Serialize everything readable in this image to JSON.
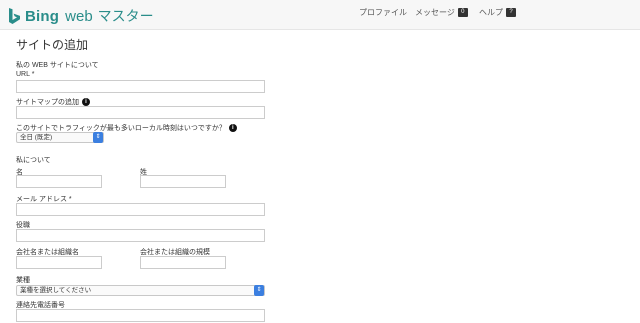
{
  "header": {
    "logo_brand": "Bing",
    "logo_web": "web",
    "logo_master": "マスター",
    "nav": {
      "profile": "プロファイル",
      "messages": "メッセージ",
      "messages_count": "0",
      "help": "ヘルプ",
      "help_count": "?"
    }
  },
  "form": {
    "title": "サイトの追加",
    "my_site_heading": "私の WEB サイトについて",
    "url_label": "URL *",
    "url_value": "",
    "sitemap_label": "サイトマップの追加",
    "sitemap_value": "",
    "traffic_label": "このサイトでトラフィックが最も多いローカル時刻はいつですか？",
    "traffic_select": "全日 (既定)",
    "about_me_heading": "私について",
    "first_name_label": "名",
    "last_name_label": "姓",
    "email_label": "メール アドレス *",
    "job_title_label": "役職",
    "company_label": "会社名または組織名",
    "company_size_label": "会社または組織の規模",
    "industry_label": "業種",
    "industry_select": "業種を選択してください",
    "phone_label": "連絡先電話番号"
  },
  "colors": {
    "brand": "#2a8d8a",
    "select_accent": "#3b7fe0"
  }
}
